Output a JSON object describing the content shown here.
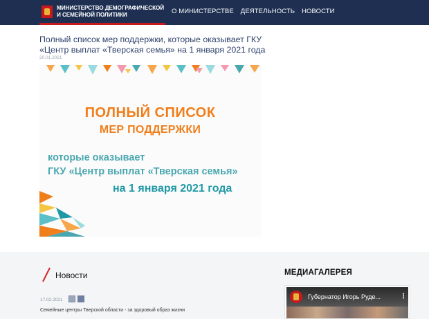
{
  "header": {
    "logo_text": "МИНИСТЕРСТВО ДЕМОГРАФИЧЕСКОЙ И СЕМЕЙНОЙ ПОЛИТИКИ",
    "nav": [
      "О МИНИСТЕРСТВЕ",
      "ДЕЯТЕЛЬНОСТЬ",
      "НОВОСТИ"
    ]
  },
  "article": {
    "title": "Полный список мер поддержки, которые оказывает ГКУ «Центр выплат «Тверская семья» на 1 января 2021 года",
    "date": "20.01.2021",
    "banner": {
      "heading_1": "ПОЛНЫЙ СПИСОК",
      "heading_2": "МЕР ПОДДЕРЖКИ",
      "sub_1": "которые оказывает",
      "sub_2": "ГКУ «Центр выплат «Тверская семья»",
      "date_line": "на 1 января 2021 года"
    }
  },
  "news": {
    "section_title": "Новости",
    "items": [
      {
        "date": "17.02.2021",
        "text": "Семейные центры Тверской области - за здоровый образ жизни"
      }
    ]
  },
  "media": {
    "section_title": "МЕДИАГАЛЕРЕЯ",
    "video_title": "Губернатор Игорь Руде...",
    "menu_glyph": "⋮"
  },
  "colors": {
    "header_bg": "#1e2f52",
    "accent_red": "#c8191e",
    "banner_orange": "#f07e1a",
    "banner_teal": "#1f98a6"
  }
}
